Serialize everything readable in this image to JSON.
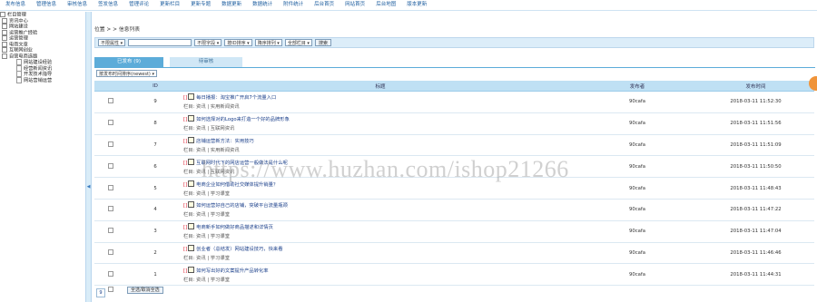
{
  "topnav": [
    "发布信息",
    "管理信息",
    "审核信息",
    "签发信息",
    "管理评论",
    "更新栏目",
    "更新专题",
    "数据更新",
    "数据统计",
    "附件统计",
    "后台首页",
    "网站首页",
    "后台地图",
    "版本更新"
  ],
  "sidebar": {
    "root": "栏目管理",
    "items": [
      {
        "label": "资讯中心",
        "type": "folder"
      },
      {
        "label": "网站建设",
        "type": "folder"
      },
      {
        "label": "运营推广经验",
        "type": "folder"
      },
      {
        "label": "运营管理",
        "type": "folder"
      },
      {
        "label": "电商文章",
        "type": "folder"
      },
      {
        "label": "互联网创业",
        "type": "folder"
      },
      {
        "label": "自营电商选题",
        "type": "folder"
      },
      {
        "label": "网站建设经验",
        "type": "doc"
      },
      {
        "label": "经营新闻资讯",
        "type": "doc"
      },
      {
        "label": "开发技术指导",
        "type": "doc"
      },
      {
        "label": "网站营销运营",
        "type": "doc"
      }
    ]
  },
  "breadcrumb": "位置 > > 信息列表",
  "filter": {
    "select1": "不限属性",
    "search_value": "",
    "select2": "不限字段",
    "select3": "按ID排序",
    "select4": "降序排列",
    "select5": "全部栏目",
    "button": "搜索"
  },
  "tabs": {
    "active": "已发布 (9)",
    "inactive": "待审核"
  },
  "sort_select": "按发布时间排序(newest)",
  "table": {
    "headers": [
      "",
      "ID",
      "标题",
      "发布者",
      "发布时间"
    ],
    "rows": [
      {
        "id": "9",
        "title": "每日播报：淘宝推广开启7个流量入口",
        "category": "栏目: 资讯 | 实用新闻资讯",
        "author": "90cafa",
        "time": "2018-03-11 11:52:30"
      },
      {
        "id": "8",
        "title": "如何选择对的Logo来打造一个好的品牌形象",
        "category": "栏目: 资讯 | 互联网资讯",
        "author": "90cafa",
        "time": "2018-03-11 11:51:56"
      },
      {
        "id": "7",
        "title": "店铺运营新方法：实用技巧",
        "category": "栏目: 资讯 | 实用新闻资讯",
        "author": "90cafa",
        "time": "2018-03-11 11:51:09"
      },
      {
        "id": "6",
        "title": "互联网时代下的网店运营一般做法是什么呢",
        "category": "栏目: 资讯 | 互联网资讯",
        "author": "90cafa",
        "time": "2018-03-11 11:50:50"
      },
      {
        "id": "5",
        "title": "电商企业如何借助社交媒体提升销量？",
        "category": "栏目: 资讯 | 学习课堂",
        "author": "90cafa",
        "time": "2018-03-11 11:48:43"
      },
      {
        "id": "4",
        "title": "如何运营好自己的店铺，突破平台流量瓶颈",
        "category": "栏目: 资讯 | 学习课堂",
        "author": "90cafa",
        "time": "2018-03-11 11:47:22"
      },
      {
        "id": "3",
        "title": "电商新手如何做好商品描述和详情页",
        "category": "栏目: 资讯 | 学习课堂",
        "author": "90cafa",
        "time": "2018-03-11 11:47:04"
      },
      {
        "id": "2",
        "title": "创业者（总结发）网站建设技巧，快来看",
        "category": "栏目: 资讯 | 学习课堂",
        "author": "90cafa",
        "time": "2018-03-11 11:46:46"
      },
      {
        "id": "1",
        "title": "如何写出好的文案提升产品转化率",
        "category": "栏目: 资讯 | 学习课堂",
        "author": "90cafa",
        "time": "2018-03-11 11:44:31"
      }
    ]
  },
  "bottom_button": "全选/取消全选",
  "pager": "9",
  "watermark": "https://www.huzhan.com/ishop21266"
}
